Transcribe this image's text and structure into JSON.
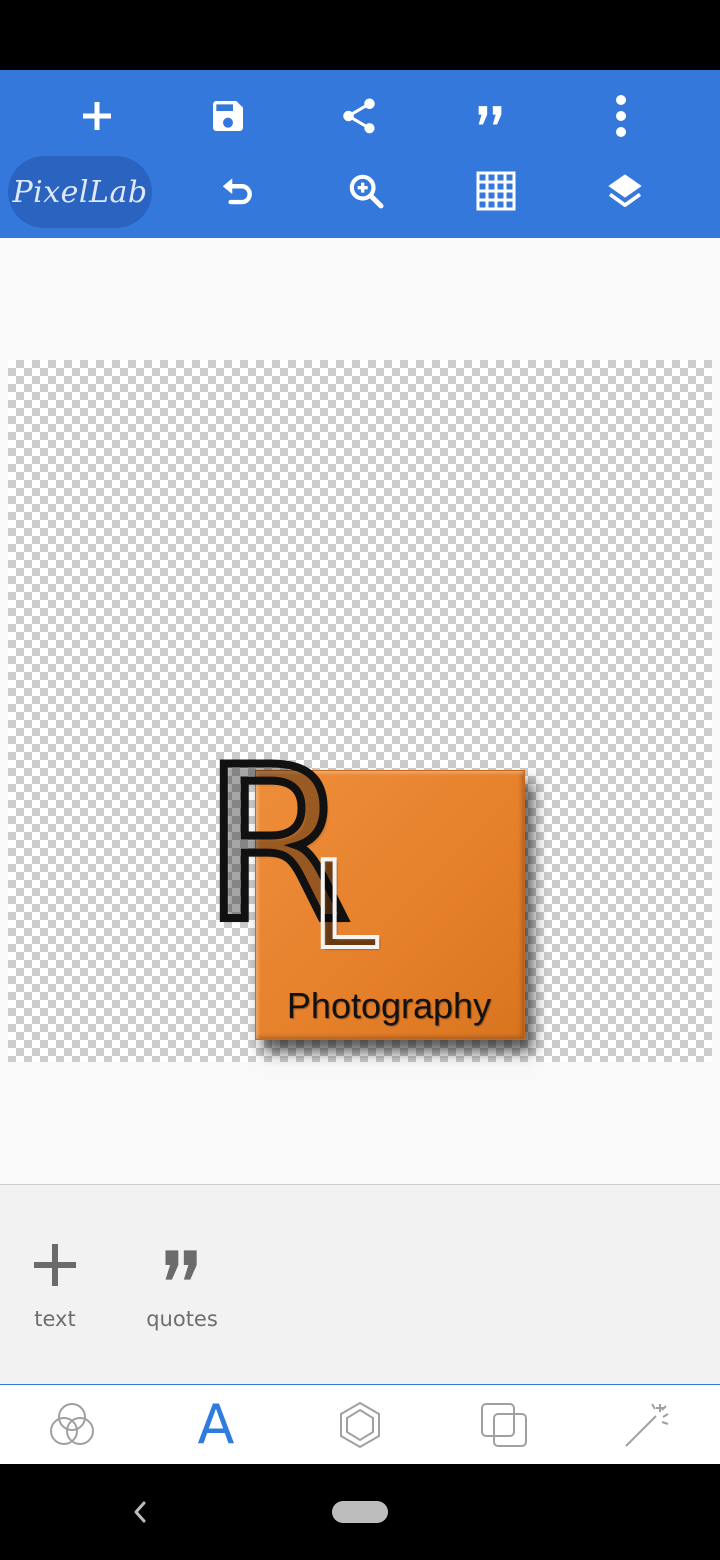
{
  "app": {
    "name": "PixelLab"
  },
  "toolbar": {
    "top_row": [
      {
        "icon": "plus-icon"
      },
      {
        "icon": "save-icon"
      },
      {
        "icon": "share-icon"
      },
      {
        "icon": "quote-icon"
      },
      {
        "icon": "more-vert-icon"
      }
    ],
    "bottom_row": [
      {
        "icon": "undo-icon"
      },
      {
        "icon": "zoom-in-icon"
      },
      {
        "icon": "grid-icon"
      },
      {
        "icon": "layers-icon"
      }
    ],
    "color": "#3478db"
  },
  "canvas": {
    "letter_r": "R",
    "letter_l": "L",
    "caption": "Photography",
    "square_color": "#e8862f"
  },
  "tool_panel": {
    "items": [
      {
        "label": "text",
        "icon": "plus-icon"
      },
      {
        "label": "quotes",
        "icon": "quote-icon"
      }
    ]
  },
  "bottom_tabs": {
    "items": [
      {
        "icon": "blend-circles-icon"
      },
      {
        "icon": "text-icon",
        "glyph": "A",
        "active": true
      },
      {
        "icon": "hexagon-icon"
      },
      {
        "icon": "overlap-squares-icon"
      },
      {
        "icon": "magic-wand-icon"
      }
    ],
    "active_color": "#2f7be0"
  },
  "navigation": {
    "back_icon": "back-chevron-icon",
    "home_icon": "home-pill-icon"
  }
}
